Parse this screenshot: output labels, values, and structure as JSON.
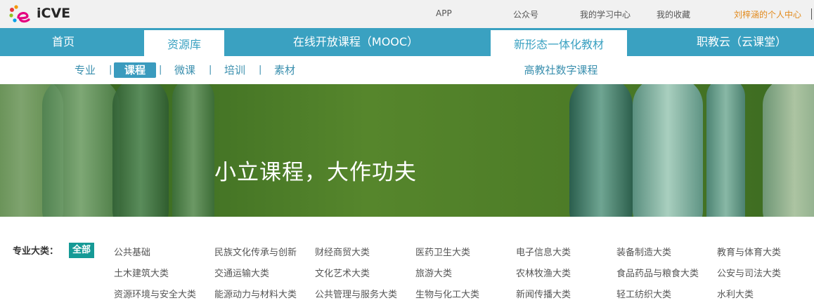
{
  "colors": {
    "topbar_bg": "#f1f1f1",
    "nav_bg": "#3aa1c1",
    "accent_teal": "#169a96",
    "user_link": "#e28a1c"
  },
  "logo": {
    "text": "iCVE"
  },
  "topbar": {
    "links": [
      "APP",
      "公众号",
      "我的学习中心",
      "我的收藏"
    ],
    "user_center": "刘梓涵的个人中心"
  },
  "nav": {
    "items": [
      "首页",
      "资源库",
      "在线开放课程（MOOC）",
      "新形态一体化教材",
      "职教云（云课堂）"
    ],
    "active": "资源库"
  },
  "subnav": {
    "items": [
      "专业",
      "课程",
      "微课",
      "培训",
      "素材"
    ],
    "active": "课程",
    "right_link": "高教社数字课程"
  },
  "banner": {
    "slogan": "小立课程，大作功夫"
  },
  "filter": {
    "label": "专业大类：",
    "all": "全部",
    "rows": [
      [
        "公共基础",
        "民族文化传承与创新",
        "财经商贸大类",
        "医药卫生大类",
        "电子信息大类",
        "装备制造大类",
        "教育与体育大类"
      ],
      [
        "土木建筑大类",
        "交通运输大类",
        "文化艺术大类",
        "旅游大类",
        "农林牧渔大类",
        "食品药品与粮食大类",
        "公安与司法大类"
      ],
      [
        "资源环境与安全大类",
        "能源动力与材料大类",
        "公共管理与服务大类",
        "生物与化工大类",
        "新闻传播大类",
        "轻工纺织大类",
        "水利大类"
      ]
    ]
  }
}
